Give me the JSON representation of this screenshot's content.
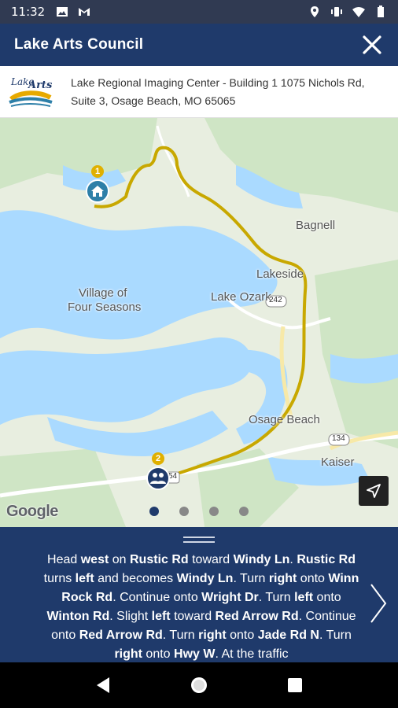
{
  "status_bar": {
    "time": "11:32",
    "left_icons": [
      "image-icon",
      "gmail-icon"
    ],
    "right_icons": [
      "location-icon",
      "vibrate-icon",
      "wifi-icon",
      "battery-icon"
    ]
  },
  "app_bar": {
    "title": "Lake Arts Council",
    "close_icon": "close-icon"
  },
  "address": {
    "logo_text": "Lake Arts",
    "text": "Lake Regional Imaging Center - Building 1 1075 Nichols Rd, Suite 3, Osage Beach, MO 65065"
  },
  "map": {
    "labels": {
      "bagnell": "Bagnell",
      "lakeside": "Lakeside",
      "village1": "Village of",
      "village2": "Four Seasons",
      "lake_ozark": "Lake Ozark",
      "osage_beach": "Osage Beach",
      "kaiser": "Kaiser",
      "route_242": "242",
      "route_134": "134",
      "route_54": "54"
    },
    "start_badge": "1",
    "end_badge": "2",
    "google_logo": "Google",
    "colors": {
      "water": "#aadaff",
      "land": "#e8eee0",
      "route": "#c8a800",
      "start_pin": "#2d7fa8",
      "end_pin": "#1f3a6b"
    },
    "pager": {
      "count": 4,
      "active": 0
    }
  },
  "directions": {
    "segments": [
      {
        "t": "Head ",
        "b": false
      },
      {
        "t": "west",
        "b": true
      },
      {
        "t": " on ",
        "b": false
      },
      {
        "t": "Rustic Rd",
        "b": true
      },
      {
        "t": " toward ",
        "b": false
      },
      {
        "t": "Windy Ln",
        "b": true
      },
      {
        "t": ". ",
        "b": false
      },
      {
        "t": "Rustic Rd",
        "b": true
      },
      {
        "t": " turns ",
        "b": false
      },
      {
        "t": "left",
        "b": true
      },
      {
        "t": " and becomes ",
        "b": false
      },
      {
        "t": "Windy Ln",
        "b": true
      },
      {
        "t": ". Turn ",
        "b": false
      },
      {
        "t": "right",
        "b": true
      },
      {
        "t": " onto ",
        "b": false
      },
      {
        "t": "Winn Rock Rd",
        "b": true
      },
      {
        "t": ". Continue onto ",
        "b": false
      },
      {
        "t": "Wright Dr",
        "b": true
      },
      {
        "t": ". Turn ",
        "b": false
      },
      {
        "t": "left",
        "b": true
      },
      {
        "t": " onto ",
        "b": false
      },
      {
        "t": "Winton Rd",
        "b": true
      },
      {
        "t": ". Slight ",
        "b": false
      },
      {
        "t": "left",
        "b": true
      },
      {
        "t": " toward ",
        "b": false
      },
      {
        "t": "Red Arrow Rd",
        "b": true
      },
      {
        "t": ". Continue onto ",
        "b": false
      },
      {
        "t": "Red Arrow Rd",
        "b": true
      },
      {
        "t": ". Turn ",
        "b": false
      },
      {
        "t": "right",
        "b": true
      },
      {
        "t": " onto ",
        "b": false
      },
      {
        "t": "Jade Rd N",
        "b": true
      },
      {
        "t": ". Turn ",
        "b": false
      },
      {
        "t": "right",
        "b": true
      },
      {
        "t": " onto ",
        "b": false
      },
      {
        "t": "Hwy W",
        "b": true
      },
      {
        "t": ". At the traffic",
        "b": false
      }
    ]
  },
  "nav_bar": {
    "back": "back-icon",
    "home": "home-icon",
    "recents": "recents-icon"
  }
}
